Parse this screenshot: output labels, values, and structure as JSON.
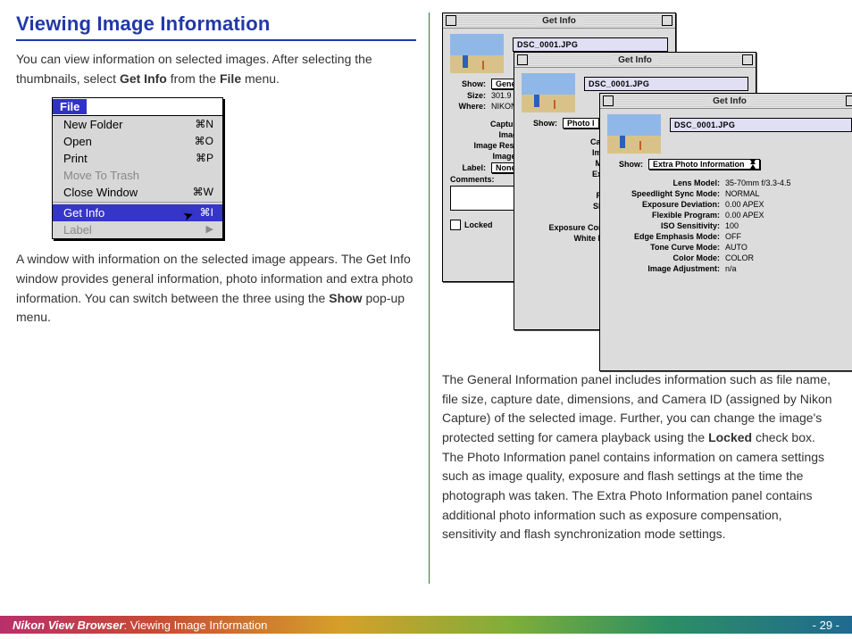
{
  "heading": "Viewing Image Information",
  "paragraph1_a": "You can view information on selected images.  After selecting the thumbnails, select ",
  "paragraph1_b": "Get Info",
  "paragraph1_c": " from the ",
  "paragraph1_d": "File",
  "paragraph1_e": " menu.",
  "file_menu": {
    "title": "File",
    "items": [
      {
        "label": "New Folder",
        "shortcut": "⌘N",
        "disabled": false,
        "selected": false,
        "sep": false,
        "sub": false
      },
      {
        "label": "Open",
        "shortcut": "⌘O",
        "disabled": false,
        "selected": false,
        "sep": false,
        "sub": false
      },
      {
        "label": "Print",
        "shortcut": "⌘P",
        "disabled": false,
        "selected": false,
        "sep": false,
        "sub": false
      },
      {
        "label": "Move To Trash",
        "shortcut": "",
        "disabled": true,
        "selected": false,
        "sep": false,
        "sub": false
      },
      {
        "label": "Close Window",
        "shortcut": "⌘W",
        "disabled": false,
        "selected": false,
        "sep": true,
        "sub": false
      },
      {
        "label": "Get Info",
        "shortcut": "⌘I",
        "disabled": false,
        "selected": true,
        "sep": false,
        "sub": false
      },
      {
        "label": "Label",
        "shortcut": "",
        "disabled": true,
        "selected": false,
        "sep": false,
        "sub": true
      }
    ]
  },
  "paragraph2_a": "A window with information on the selected image appears. The Get Info window provides general information, photo information and extra photo information.  You can switch between the three using the ",
  "paragraph2_b": "Show",
  "paragraph2_c": " pop-up menu.",
  "windows": {
    "title": "Get Info",
    "filename": "DSC_0001.JPG",
    "show_label": "Show:",
    "w1": {
      "select": "Genera",
      "rows": [
        {
          "lab": "Size:",
          "val": "301.9"
        },
        {
          "lab": "Where:",
          "val": "NIKON"
        }
      ],
      "section_rows": [
        "Capture Dat",
        "Image Siz",
        "Image Resolutio",
        "Image Dept"
      ],
      "label_field": {
        "lab": "Label:",
        "val": "None"
      },
      "comments_label": "Comments:",
      "locked_label": "Locked"
    },
    "w2": {
      "select": "Photo I",
      "rows": [
        "Camera M",
        "Image Qu",
        "Metering",
        "Exposure",
        "Speed l",
        "Focal Le",
        "Shutter S",
        "F Nu",
        "Exposure Compensa",
        "White Balance"
      ]
    },
    "w3": {
      "select": "Extra Photo Information",
      "rows": [
        {
          "lab": "Lens Model:",
          "val": "35-70mm f/3.3-4.5"
        },
        {
          "lab": "Speedlight Sync Mode:",
          "val": "NORMAL"
        },
        {
          "lab": "Exposure Deviation:",
          "val": "0.00 APEX"
        },
        {
          "lab": "Flexible Program:",
          "val": "0.00 APEX"
        },
        {
          "lab": "ISO Sensitivity:",
          "val": "100"
        },
        {
          "lab": "Edge Emphasis Mode:",
          "val": "OFF"
        },
        {
          "lab": "Tone Curve Mode:",
          "val": "AUTO"
        },
        {
          "lab": "Color Mode:",
          "val": "COLOR"
        },
        {
          "lab": "Image Adjustment:",
          "val": "n/a"
        }
      ]
    }
  },
  "right_para_a": "The General Information panel includes information such as file name, file size, capture date, dimensions, and Camera ID (assigned by Nikon Capture) of the selected image. Further, you can change the image's protected setting for camera playback using the ",
  "right_para_b": "Locked",
  "right_para_c": " check box.  The Photo Information panel contains information on camera settings such as image quality, exposure and flash settings at the time the photograph was taken. The Extra Photo Information panel contains additional photo information such as exposure compensation, sensitivity and flash synchronization mode settings.",
  "footer": {
    "app": "Nikon View Browser",
    "section": ":  Viewing Image Information",
    "page": "- 29 -"
  }
}
